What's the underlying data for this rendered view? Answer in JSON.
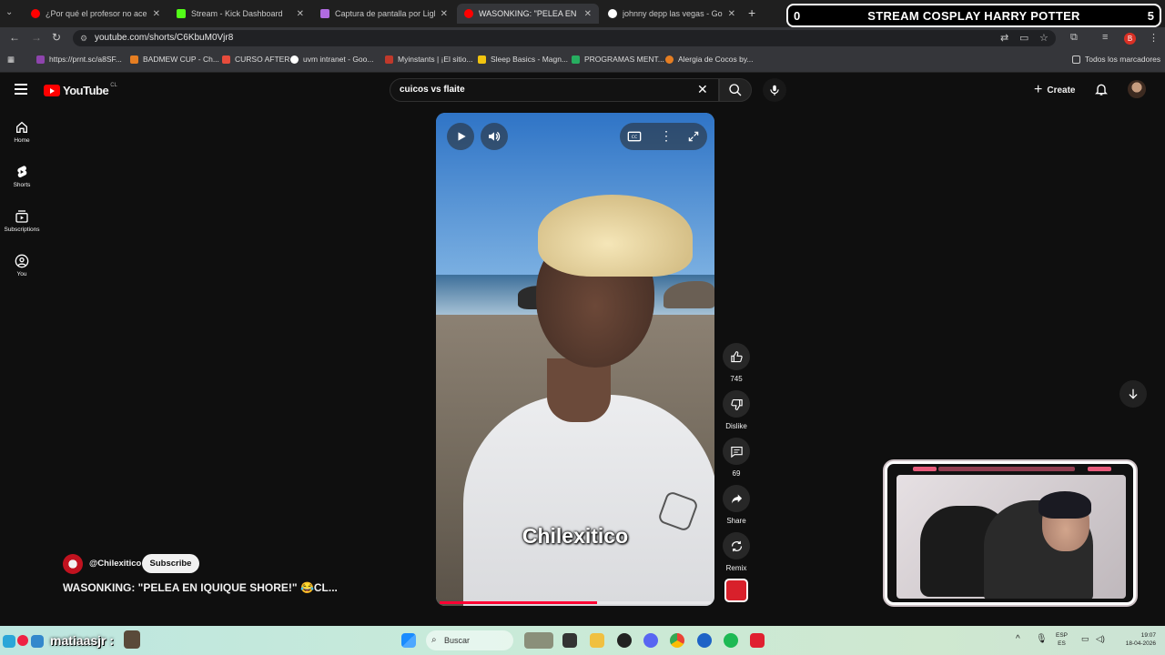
{
  "browser": {
    "tabs": [
      {
        "title": "¿Por qué el profesor no acepta",
        "color": "#ff0000"
      },
      {
        "title": "Stream - Kick Dashboard",
        "color": "#53fc18"
      },
      {
        "title": "Captura de pantalla por Lightsh",
        "color": "#b06be0"
      },
      {
        "title": "WASONKING: \"PELEA EN IQUIQ",
        "color": "#ff0000"
      },
      {
        "title": "johnny depp las vegas - Google",
        "color": "#ffffff"
      }
    ],
    "url": "youtube.com/shorts/C6KbuM0Vjr8",
    "profile_initial": "B",
    "bookmarks": [
      {
        "label": "https://prnt.sc/a8SF...",
        "color": "#8e44ad"
      },
      {
        "label": "BADMEW CUP - Ch...",
        "color": "#e67e22"
      },
      {
        "label": "CURSO AFTER",
        "color": "#e74c3c"
      },
      {
        "label": "uvm intranet - Goo...",
        "color": "#ffffff"
      },
      {
        "label": "Myinstants | ¡El sitio...",
        "color": "#c0392b"
      },
      {
        "label": "Sleep Basics - Magn...",
        "color": "#f1c40f"
      },
      {
        "label": "PROGRAMAS MENT...",
        "color": "#27ae60"
      },
      {
        "label": "Alergia de Cocos by...",
        "color": "#e67e22"
      }
    ],
    "all_bookmarks": "Todos los marcadores"
  },
  "stream_overlay": {
    "left_num": "0",
    "title": "STREAM COSPLAY HARRY POTTER",
    "right_num": "5"
  },
  "youtube": {
    "logo_text": "YouTube",
    "country_code": "CL",
    "search_query": "cuicos vs flaite",
    "create_label": "Create",
    "sidebar": [
      {
        "label": "Home",
        "icon": "home-icon"
      },
      {
        "label": "Shorts",
        "icon": "shorts-icon"
      },
      {
        "label": "Subscriptions",
        "icon": "subscriptions-icon"
      },
      {
        "label": "You",
        "icon": "you-icon"
      }
    ],
    "video": {
      "caption": "Chilexitico",
      "progress": 0.58
    },
    "actions": {
      "likes": "745",
      "dislike_label": "Dislike",
      "comments": "69",
      "share_label": "Share",
      "remix_label": "Remix"
    },
    "channel": {
      "handle": "@Chilexitico",
      "subscribe_label": "Subscribe"
    },
    "short_title": "WASONKING: \"PELEA EN IQUIQUE SHORE!\" 😂CL..."
  },
  "taskbar": {
    "username": "matiaasjr :",
    "search_placeholder": "Buscar",
    "lang_top": "ESP",
    "lang_bottom": "ES",
    "time": "19:07",
    "date": "18-04-2026"
  },
  "colors": {
    "youtube_red": "#ff0000",
    "progress_red": "#ff0033",
    "background": "#0f0f0f"
  }
}
